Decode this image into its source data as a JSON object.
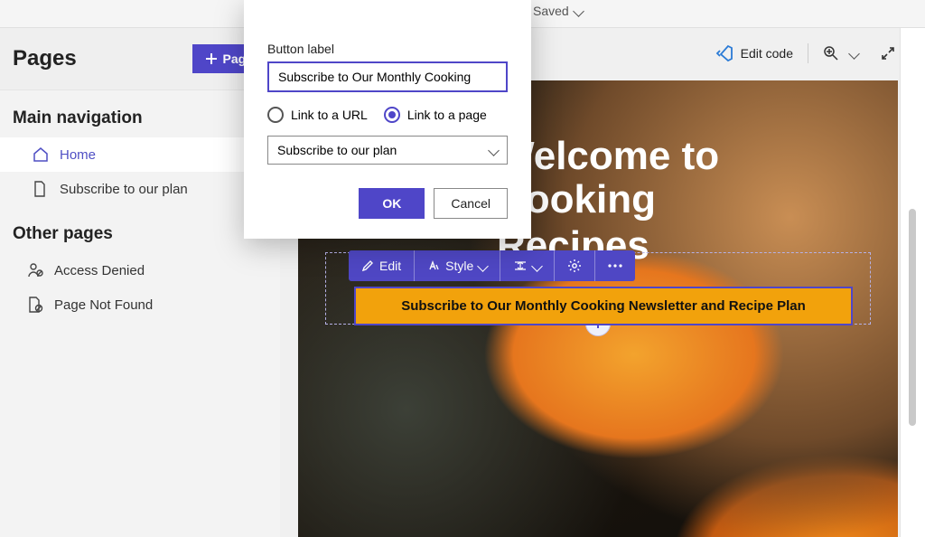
{
  "top": {
    "saved_label": "Saved"
  },
  "sidebar": {
    "title": "Pages",
    "add_button": "Page",
    "section_main": "Main navigation",
    "section_other": "Other pages",
    "items_main": [
      {
        "label": "Home"
      },
      {
        "label": "Subscribe to our plan"
      }
    ],
    "items_other": [
      {
        "label": "Access Denied"
      },
      {
        "label": "Page Not Found"
      }
    ]
  },
  "canvas_toolbar": {
    "edit_code": "Edit code"
  },
  "hero": {
    "title_line1": "Welcome to Cooking",
    "title_line2": "Recipes",
    "subtitle_fragment": "cipes"
  },
  "cta": {
    "label": "Subscribe to Our Monthly Cooking Newsletter and Recipe Plan"
  },
  "float_toolbar": {
    "edit": "Edit",
    "style": "Style"
  },
  "dialog": {
    "field_label": "Button label",
    "input_value": "Subscribe to Our Monthly Cooking",
    "radio_url": "Link to a URL",
    "radio_page": "Link to a page",
    "selected_page": "Subscribe to our plan",
    "ok": "OK",
    "cancel": "Cancel"
  }
}
